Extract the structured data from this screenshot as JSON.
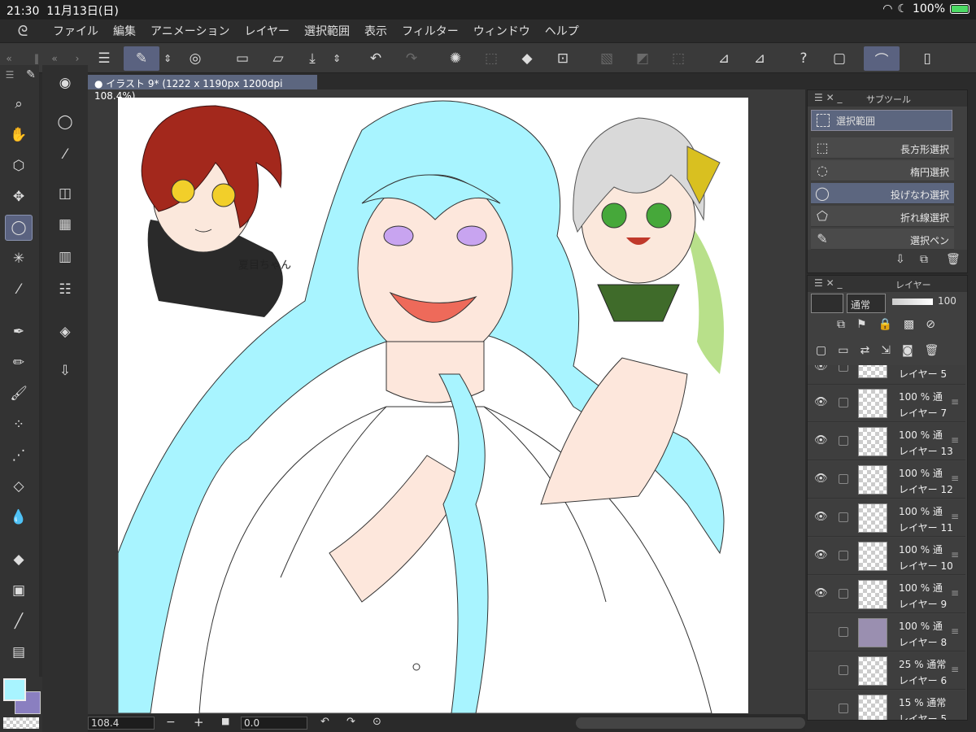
{
  "status": {
    "time": "21:30",
    "date": "11月13日(日)",
    "battery": "100%"
  },
  "menu": [
    "ファイル",
    "編集",
    "アニメーション",
    "レイヤー",
    "選択範囲",
    "表示",
    "フィルター",
    "ウィンドウ",
    "ヘルプ"
  ],
  "document": {
    "tab_label": "イラスト 9* (1222 x 1190px 1200dpi 108.4%)",
    "signature": "夏目ちゃん"
  },
  "colors": {
    "main": "#a8f4ff",
    "sub": "#8a7fc0",
    "accent": "#5c667f"
  },
  "subtool": {
    "title": "サブツール",
    "group": "選択範囲",
    "items": [
      {
        "label": "長方形選択",
        "icon": "rect-select-icon"
      },
      {
        "label": "楕円選択",
        "icon": "ellipse-select-icon"
      },
      {
        "label": "投げなわ選択",
        "icon": "lasso-select-icon"
      },
      {
        "label": "折れ線選択",
        "icon": "polyline-select-icon"
      },
      {
        "label": "選択ペン",
        "icon": "selection-pen-icon"
      }
    ]
  },
  "layers": {
    "title": "レイヤー",
    "blend": "通常",
    "opacity": "100",
    "top_partial": "レイヤー 5",
    "bottom_partial": "レイヤー 5",
    "items": [
      {
        "opacity": "100 % 通",
        "name": "レイヤー 7",
        "visible": true
      },
      {
        "opacity": "100 % 通",
        "name": "レイヤー 13",
        "visible": true
      },
      {
        "opacity": "100 % 通",
        "name": "レイヤー 12",
        "visible": true
      },
      {
        "opacity": "100 % 通",
        "name": "レイヤー 11",
        "visible": true
      },
      {
        "opacity": "100 % 通",
        "name": "レイヤー 10",
        "visible": true
      },
      {
        "opacity": "100 % 通",
        "name": "レイヤー 9",
        "visible": true
      },
      {
        "opacity": "100 % 通",
        "name": "レイヤー 8",
        "visible": false
      },
      {
        "opacity": "25 % 通常",
        "name": "レイヤー 6",
        "visible": false
      },
      {
        "opacity": "15 % 通常",
        "name": "レイヤー 5",
        "visible": false
      }
    ]
  },
  "bottom": {
    "zoom": "108.4",
    "angle": "0.0"
  }
}
